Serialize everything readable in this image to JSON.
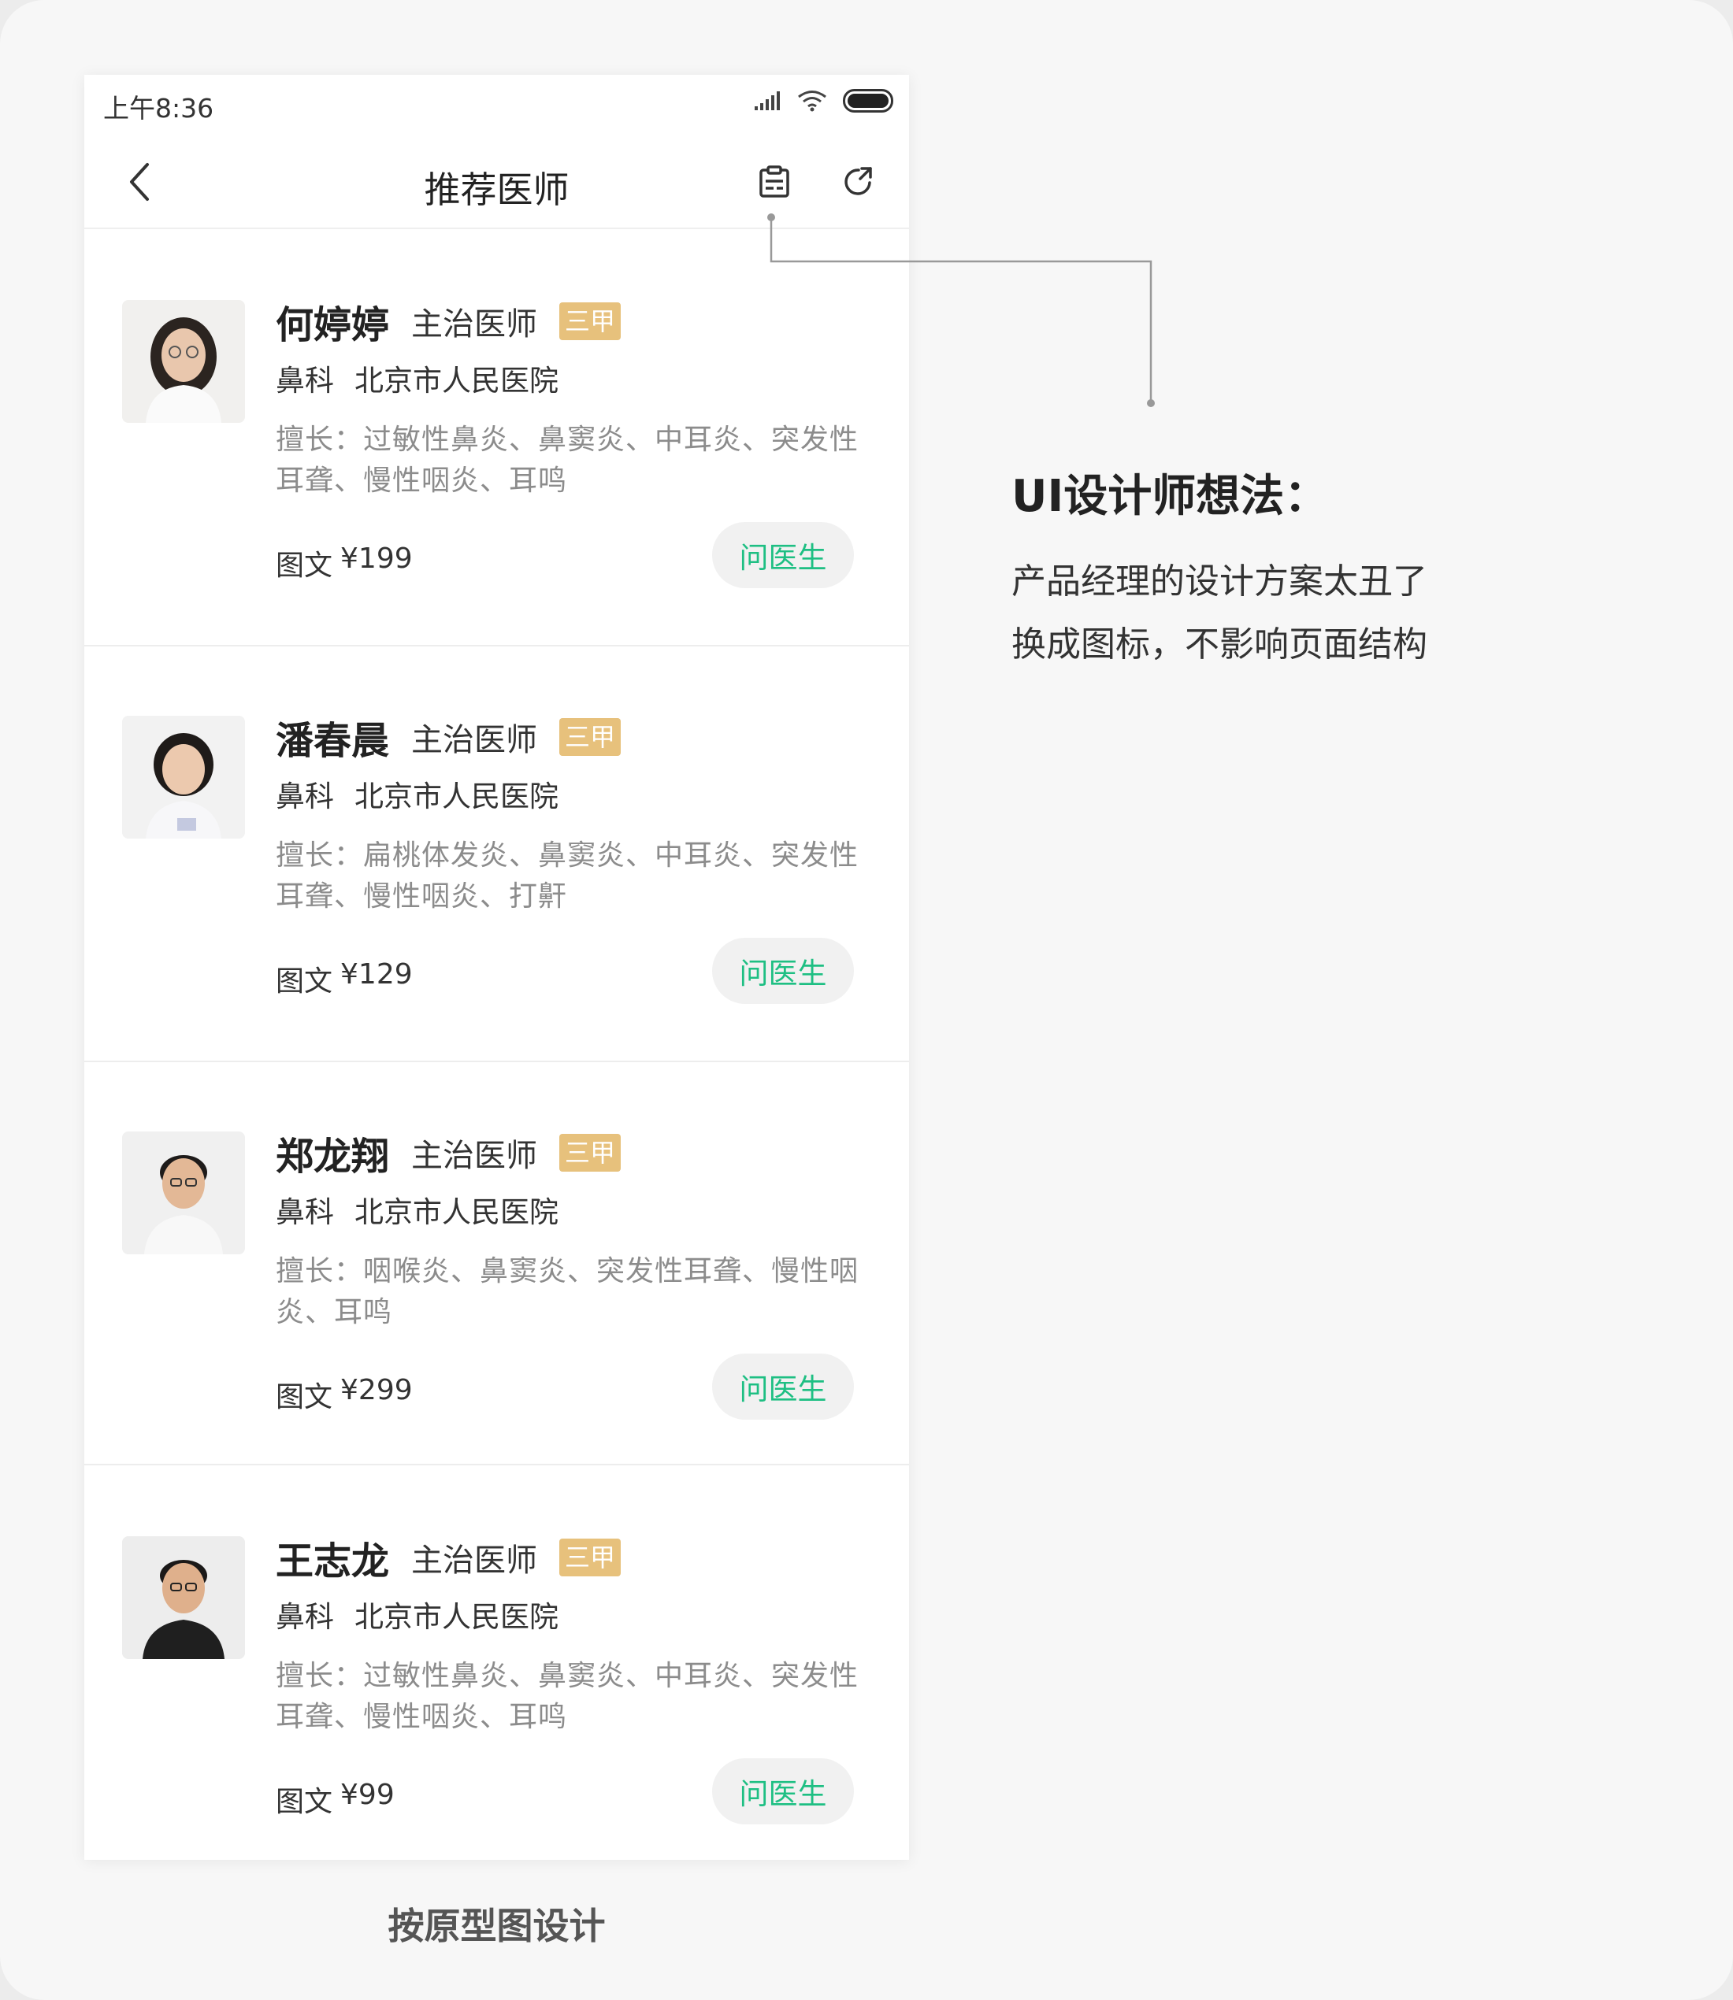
{
  "status_bar": {
    "time": "上午8:36"
  },
  "nav": {
    "title": "推荐医师"
  },
  "doctors": [
    {
      "name": "何婷婷",
      "title": "主治医师",
      "badge": "三甲",
      "department": "鼻科",
      "hospital": "北京市人民医院",
      "specialty": "擅长：过敏性鼻炎、鼻窦炎、中耳炎、突发性耳聋、慢性咽炎、耳鸣",
      "price_label": "图文",
      "price": "¥199",
      "action": "问医生"
    },
    {
      "name": "潘春晨",
      "title": "主治医师",
      "badge": "三甲",
      "department": "鼻科",
      "hospital": "北京市人民医院",
      "specialty": "擅长：扁桃体发炎、鼻窦炎、中耳炎、突发性耳聋、慢性咽炎、打鼾",
      "price_label": "图文",
      "price": "¥129",
      "action": "问医生"
    },
    {
      "name": "郑龙翔",
      "title": "主治医师",
      "badge": "三甲",
      "department": "鼻科",
      "hospital": "北京市人民医院",
      "specialty": "擅长：咽喉炎、鼻窦炎、突发性耳聋、慢性咽炎、耳鸣",
      "price_label": "图文",
      "price": "¥299",
      "action": "问医生"
    },
    {
      "name": "王志龙",
      "title": "主治医师",
      "badge": "三甲",
      "department": "鼻科",
      "hospital": "北京市人民医院",
      "specialty": "擅长：过敏性鼻炎、鼻窦炎、中耳炎、突发性耳聋、慢性咽炎、耳鸣",
      "price_label": "图文",
      "price": "¥99",
      "action": "问医生"
    }
  ],
  "caption": "按原型图设计",
  "annotation": {
    "title": "UI设计师想法：",
    "line1": "产品经理的设计方案太丑了",
    "line2": "换成图标，不影响页面结构"
  },
  "colors": {
    "accent_green": "#1ebf83",
    "badge_gold": "#e7c17c",
    "text_gray": "#8c8c8c"
  },
  "icons": {
    "back": "chevron-left-icon",
    "history": "clipboard-icon",
    "share": "share-arrow-icon"
  }
}
